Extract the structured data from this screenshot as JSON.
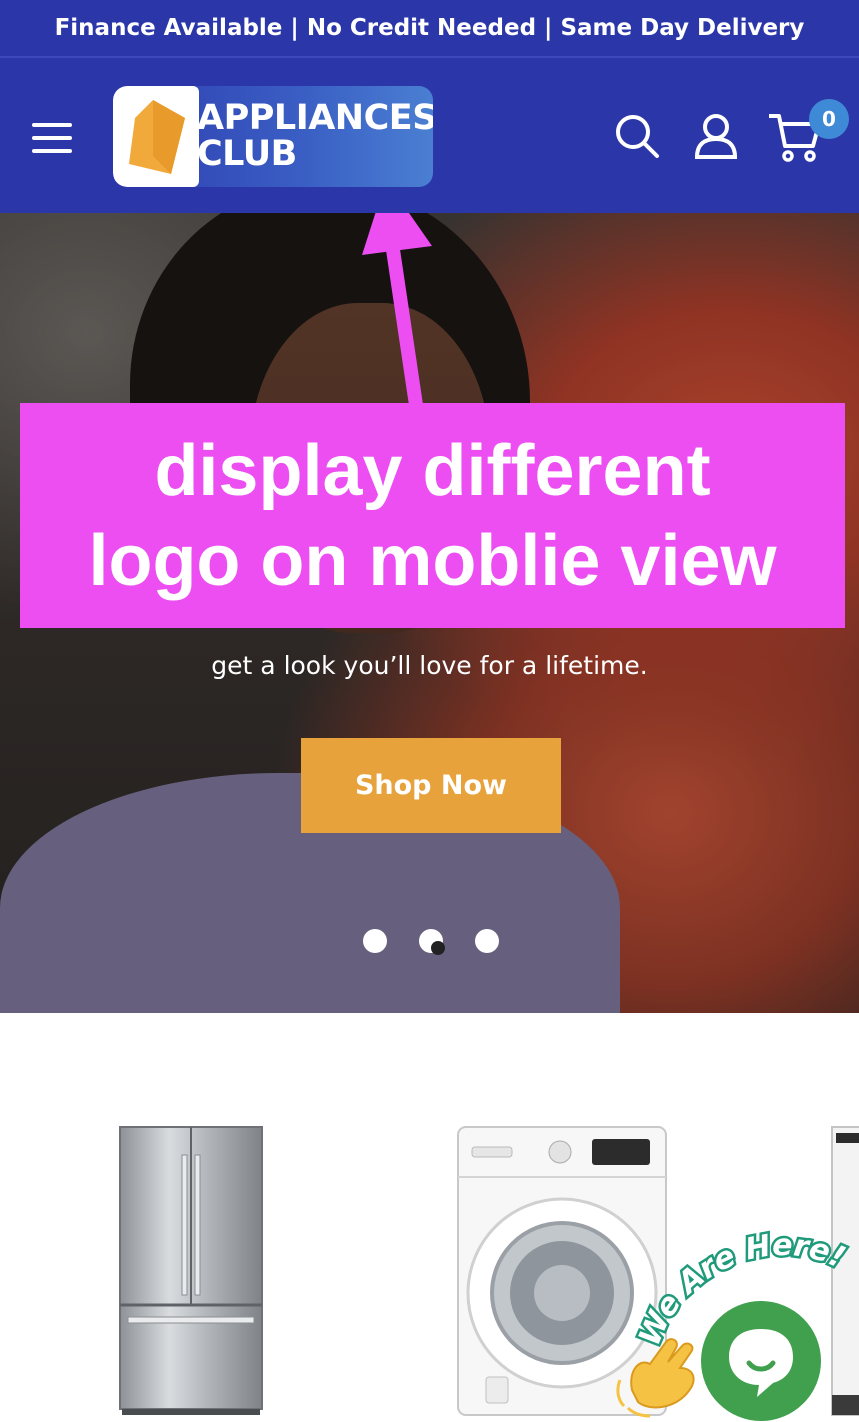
{
  "announcement": "Finance Available | No Credit Needed | Same Day Delivery",
  "header": {
    "logo_line1": "APPLIANCES",
    "logo_line2": "CLUB",
    "cart_count": "0"
  },
  "hero": {
    "annotation_line1": "display different",
    "annotation_line2": "logo on moblie view",
    "tagline": "get a look you’ll love for a lifetime.",
    "cta_label": "Shop Now",
    "slides": 3,
    "active_slide": 2
  },
  "chat": {
    "label": "We Are Here!"
  },
  "colors": {
    "header_bg": "#2b36a8",
    "accent": "#e8a23c",
    "annotation": "#ec4ef2",
    "chat": "#40a04e",
    "badge": "#3f8ad6"
  }
}
